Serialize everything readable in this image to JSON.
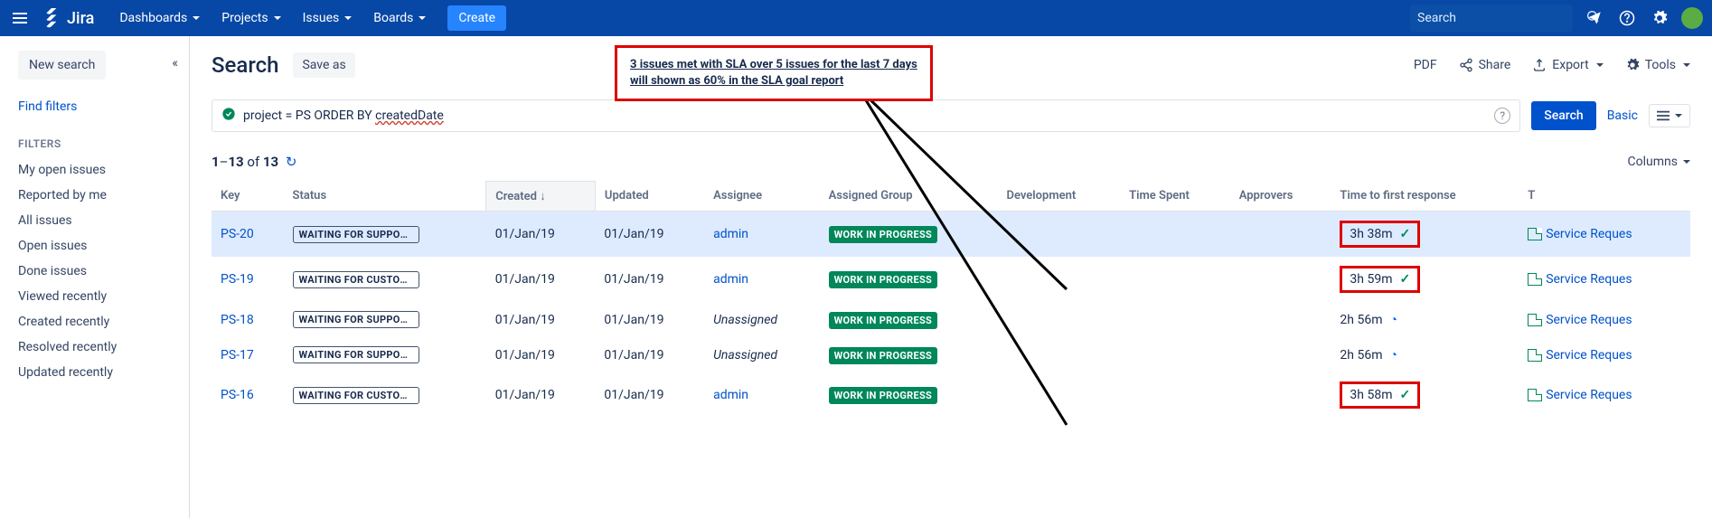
{
  "topbar": {
    "logo": "Jira",
    "nav": [
      "Dashboards",
      "Projects",
      "Issues",
      "Boards"
    ],
    "create": "Create",
    "search_placeholder": "Search"
  },
  "sidebar": {
    "new_search": "New search",
    "find_filters": "Find filters",
    "filters_heading": "FILTERS",
    "items": [
      "My open issues",
      "Reported by me",
      "All issues",
      "Open issues",
      "Done issues",
      "Viewed recently",
      "Created recently",
      "Resolved recently",
      "Updated recently"
    ]
  },
  "page": {
    "title": "Search",
    "save_as": "Save as",
    "actions": {
      "pdf": "PDF",
      "share": "Share",
      "export": "Export",
      "tools": "Tools"
    },
    "callout_line1": "3 issues met with SLA over  5 issues for the last 7 days",
    "callout_line2": "will shown as 60% in the SLA goal report"
  },
  "jql": {
    "prefix": "project = PS ORDER BY  ",
    "highlighted": "createdDate",
    "search": "Search",
    "basic": "Basic"
  },
  "results": {
    "range_from": "1",
    "range_to": "13",
    "total": "13",
    "columns_label": "Columns",
    "headers": [
      "Key",
      "Status",
      "Created",
      "Updated",
      "Assignee",
      "Assigned Group",
      "Development",
      "Time Spent",
      "Approvers",
      "Time to first response",
      "T"
    ],
    "rows": [
      {
        "key": "PS-20",
        "status": "WAITING FOR SUPPORT",
        "created": "01/Jan/19",
        "updated": "01/Jan/19",
        "assignee": "admin",
        "assignee_link": true,
        "group": "WORK IN PROGRESS",
        "sla": "3h 38m",
        "sla_state": "ok",
        "sla_boxed": true,
        "type": "Service Reques"
      },
      {
        "key": "PS-19",
        "status": "WAITING FOR CUSTOM...",
        "created": "01/Jan/19",
        "updated": "01/Jan/19",
        "assignee": "admin",
        "assignee_link": true,
        "group": "WORK IN PROGRESS",
        "sla": "3h 59m",
        "sla_state": "ok",
        "sla_boxed": true,
        "type": "Service Reques"
      },
      {
        "key": "PS-18",
        "status": "WAITING FOR SUPPORT",
        "created": "01/Jan/19",
        "updated": "01/Jan/19",
        "assignee": "Unassigned",
        "assignee_link": false,
        "group": "WORK IN PROGRESS",
        "sla": "2h 56m",
        "sla_state": "pending",
        "sla_boxed": false,
        "type": "Service Reques"
      },
      {
        "key": "PS-17",
        "status": "WAITING FOR SUPPORT",
        "created": "01/Jan/19",
        "updated": "01/Jan/19",
        "assignee": "Unassigned",
        "assignee_link": false,
        "group": "WORK IN PROGRESS",
        "sla": "2h 56m",
        "sla_state": "pending",
        "sla_boxed": false,
        "type": "Service Reques"
      },
      {
        "key": "PS-16",
        "status": "WAITING FOR CUSTOM...",
        "created": "01/Jan/19",
        "updated": "01/Jan/19",
        "assignee": "admin",
        "assignee_link": true,
        "group": "WORK IN PROGRESS",
        "sla": "3h 58m",
        "sla_state": "ok",
        "sla_boxed": true,
        "type": "Service Reques"
      }
    ]
  }
}
